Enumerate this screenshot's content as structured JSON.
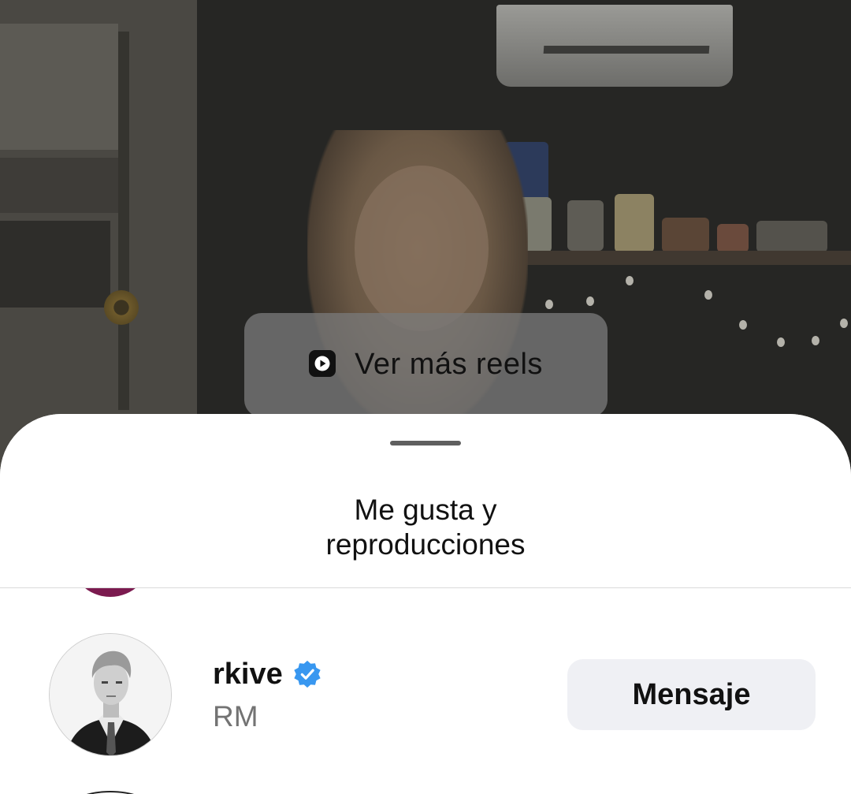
{
  "reels_button": {
    "label": "Ver más reels",
    "icon": "reels-icon"
  },
  "sheet": {
    "title_line1": "Me gusta y",
    "title_line2": "reproducciones"
  },
  "users": [
    {
      "username": "rkive",
      "verified": true,
      "full_name": "RM",
      "action_label": "Mensaje"
    }
  ],
  "colors": {
    "verified_badge": "#3897f0",
    "secondary_text": "#737373",
    "button_bg": "#eff0f4"
  }
}
